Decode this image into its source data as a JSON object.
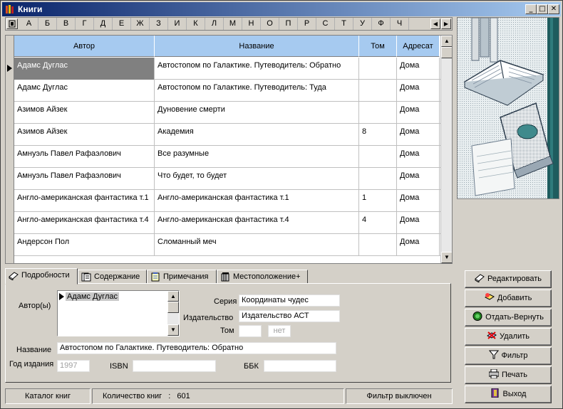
{
  "window": {
    "title": "Книги"
  },
  "alphabet": [
    "А",
    "Б",
    "В",
    "Г",
    "Д",
    "Е",
    "Ж",
    "З",
    "И",
    "К",
    "Л",
    "М",
    "Н",
    "О",
    "П",
    "Р",
    "С",
    "Т",
    "У",
    "Ф",
    "Ч"
  ],
  "grid": {
    "columns": [
      "Автор",
      "Название",
      "Том",
      "Адресат"
    ],
    "rows": [
      {
        "author": "Адамс Дуглас",
        "title": "Автостопом по Галактике. Путеводитель: Обратно",
        "volume": "",
        "addressee": "Дома",
        "selected": true
      },
      {
        "author": "Адамс Дуглас",
        "title": "Автостопом по Галактике. Путеводитель: Туда",
        "volume": "",
        "addressee": "Дома"
      },
      {
        "author": "Азимов Айзек",
        "title": "Дуновение смерти",
        "volume": "",
        "addressee": "Дома"
      },
      {
        "author": "Азимов Айзек",
        "title": "Академия",
        "volume": "8",
        "addressee": "Дома"
      },
      {
        "author": "Амнуэль Павел Рафаэлович",
        "title": "Все разумные",
        "volume": "",
        "addressee": "Дома"
      },
      {
        "author": "Амнуэль Павел Рафаэлович",
        "title": "Что будет, то будет",
        "volume": "",
        "addressee": "Дома"
      },
      {
        "author": "Англо-американская фантастика т.1",
        "title": "Англо-американская фантастика т.1",
        "volume": "1",
        "addressee": "Дома"
      },
      {
        "author": "Англо-американская фантастика т.4",
        "title": "Англо-американская фантастика т.4",
        "volume": "4",
        "addressee": "Дома"
      },
      {
        "author": "Андерсон Пол",
        "title": "Сломанный меч",
        "volume": "",
        "addressee": "Дома"
      }
    ]
  },
  "tabs": [
    "Подробности",
    "Содержание",
    "Примечания",
    "Местоположение+"
  ],
  "details": {
    "authors_label": "Автор(ы)",
    "authors": [
      "Адамс Дуглас"
    ],
    "series_label": "Серия",
    "series_value": "Координаты чудес",
    "publisher_label": "Издательство",
    "publisher_value": "Издательство АСТ",
    "volume_label": "Том",
    "volume_value": "",
    "volume_none": "нет",
    "title_label": "Название",
    "title_value": "Автостопом по Галактике. Путеводитель: Обратно",
    "year_label": "Год издания",
    "year_value": "1997",
    "isbn_label": "ISBN",
    "isbn_value": "",
    "bbk_label": "ББК",
    "bbk_value": ""
  },
  "buttons": {
    "edit": "Редактировать",
    "add": "Добавить",
    "lend_return": "Отдать-Вернуть",
    "delete": "Удалить",
    "filter": "Фильтр",
    "print": "Печать",
    "exit": "Выход"
  },
  "status": {
    "catalog": "Каталог книг",
    "count_label": "Количество книг",
    "count_sep": ":",
    "count_value": "601",
    "filter_state": "Фильтр выключен"
  }
}
